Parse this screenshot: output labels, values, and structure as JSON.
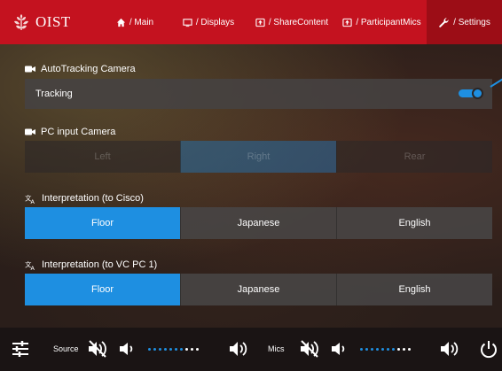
{
  "app": {
    "brand": "OIST",
    "colors": {
      "primary_red": "#c4121f",
      "active_red": "#9c0d16",
      "accent_blue": "#1e8fe1"
    }
  },
  "nav": {
    "items": [
      {
        "label": "/ Main",
        "icon": "home-icon"
      },
      {
        "label": "/ Displays",
        "icon": "display-icon"
      },
      {
        "label": "/ ShareContent",
        "icon": "share-icon"
      },
      {
        "label": "/ ParticipantMics",
        "icon": "mic-icon"
      },
      {
        "label": "/ Settings",
        "icon": "wrench-icon",
        "active": true
      }
    ]
  },
  "autotracking": {
    "title": "AutoTracking Camera",
    "row_label": "Tracking",
    "enabled": true
  },
  "pc_input": {
    "title": "PC input Camera",
    "options": [
      "Left",
      "Right",
      "Rear"
    ],
    "selected": "Right",
    "disabled": true
  },
  "interp_cisco": {
    "title": "Interpretation (to Cisco)",
    "options": [
      "Floor",
      "Japanese",
      "English"
    ],
    "selected": "Floor"
  },
  "interp_vc": {
    "title": "Interpretation (to VC PC 1)",
    "options": [
      "Floor",
      "Japanese",
      "English"
    ],
    "selected": "Floor"
  },
  "bottom": {
    "source_label": "Source",
    "mics_label": "Mics",
    "source_level": 0.7,
    "mics_level": 0.7
  }
}
